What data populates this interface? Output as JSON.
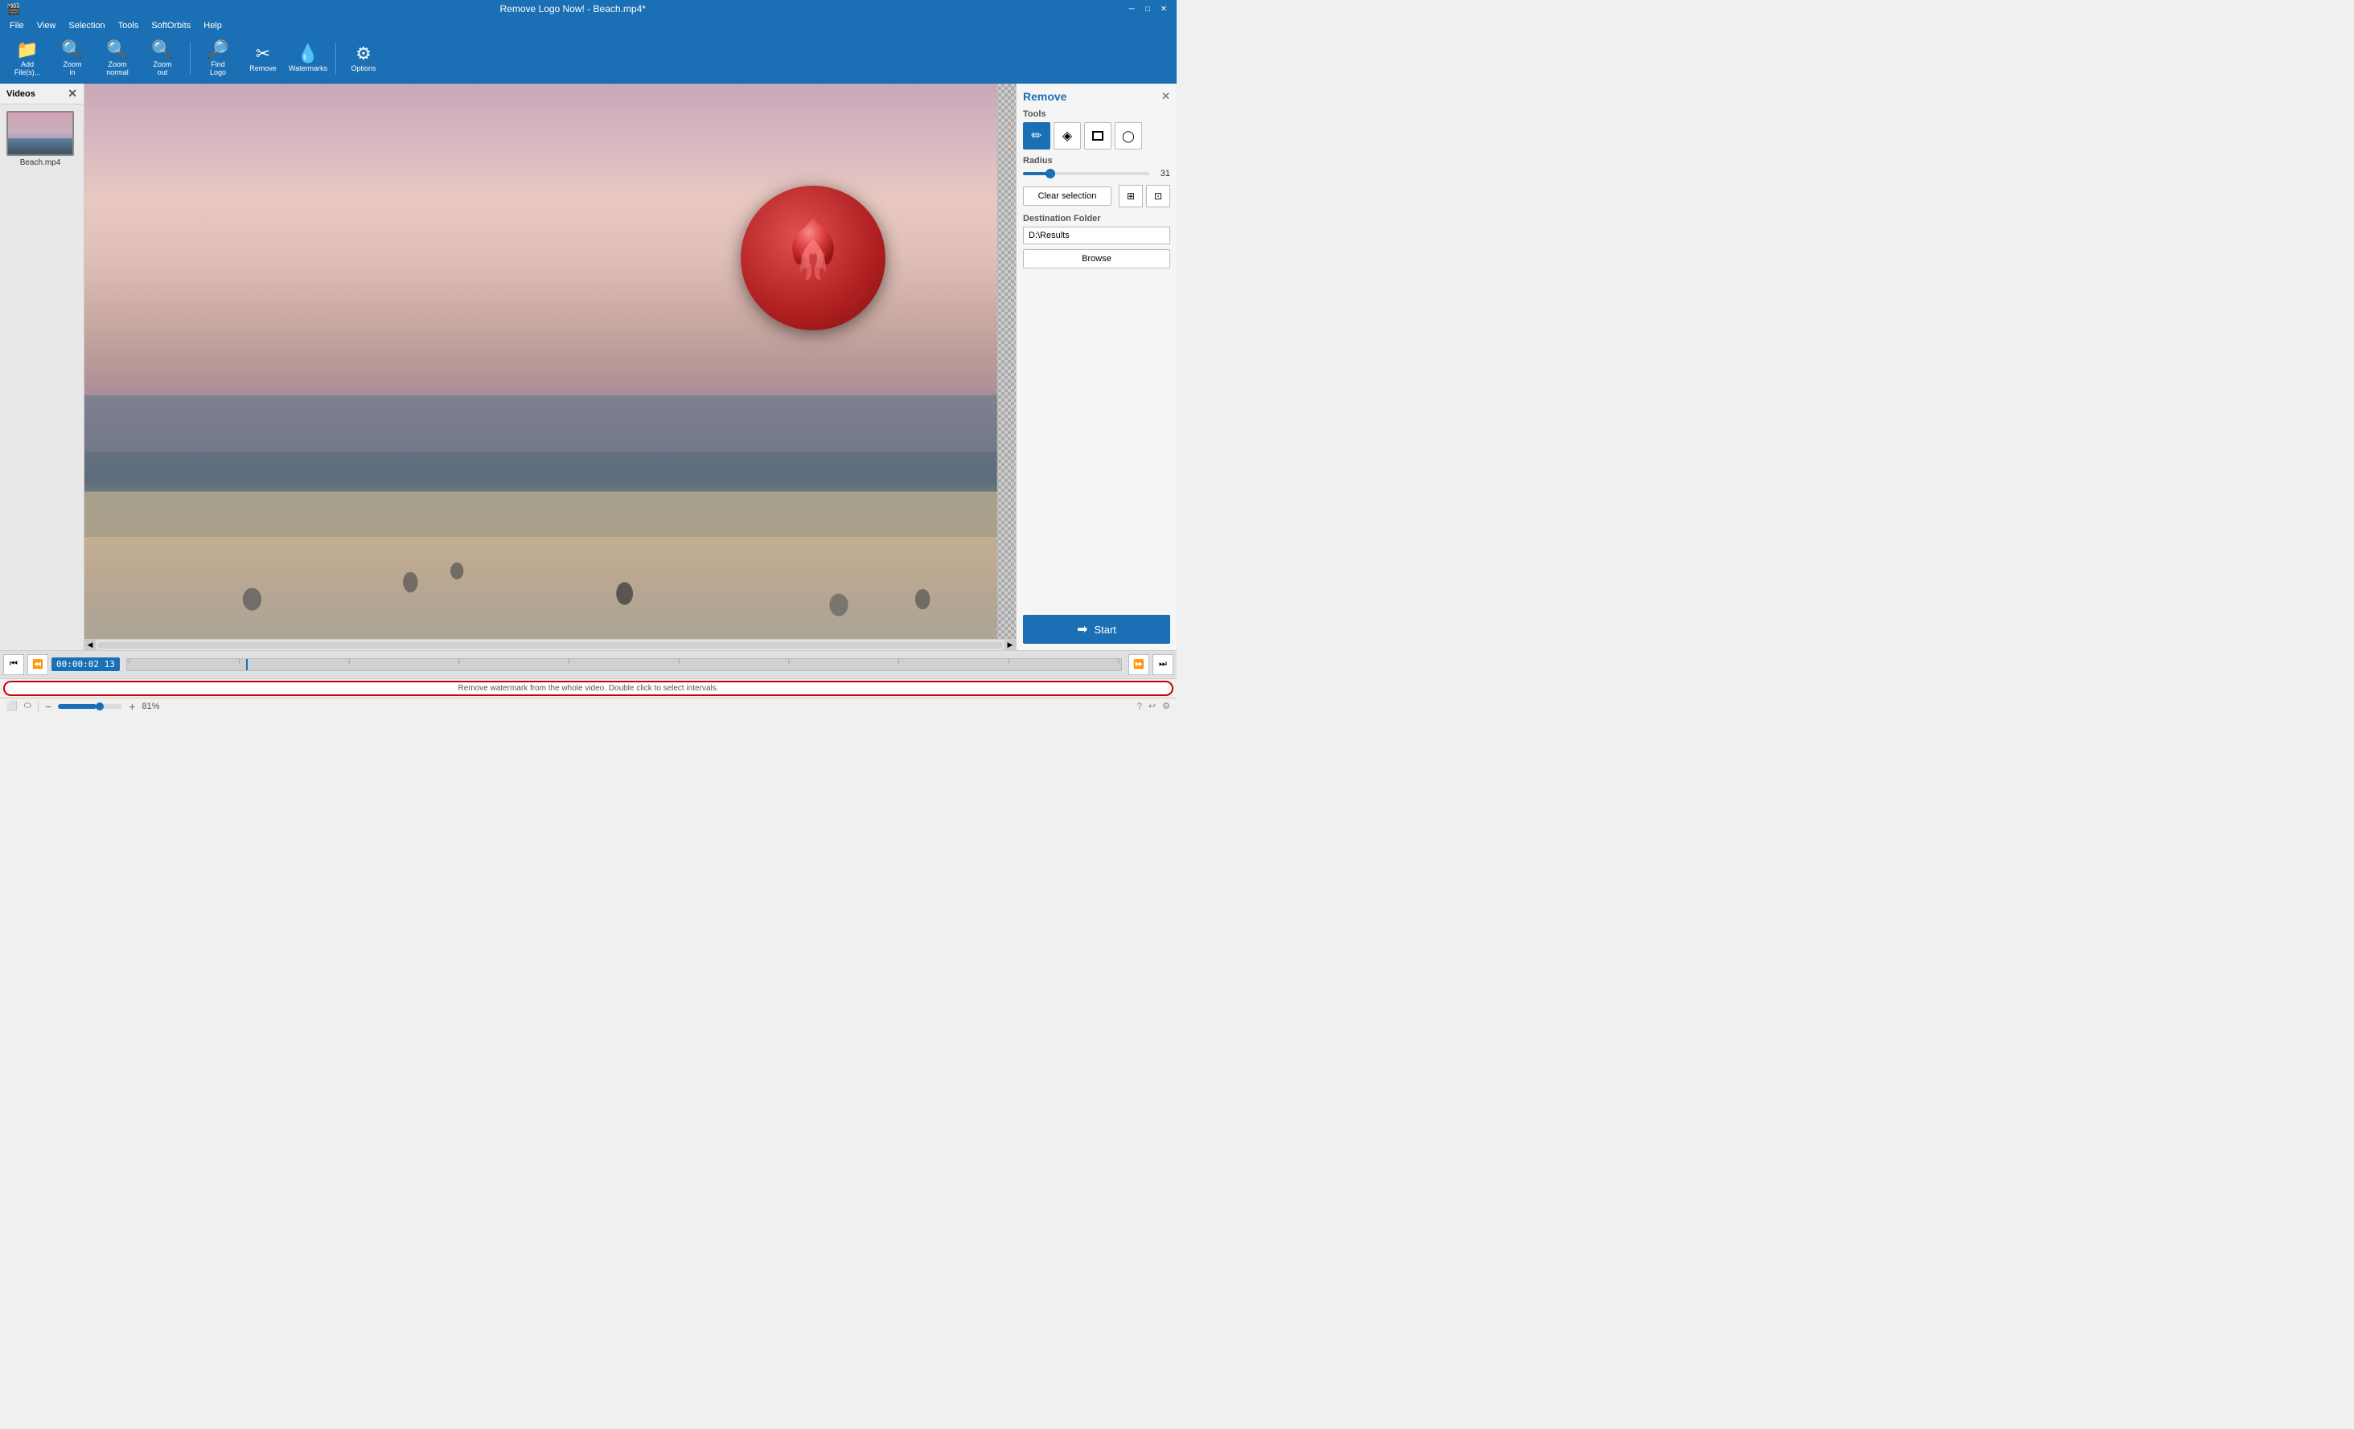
{
  "window": {
    "title": "Remove Logo Now! - Beach.mp4*",
    "app_icon": "🎬"
  },
  "titlebar": {
    "title": "Remove Logo Now! - Beach.mp4*",
    "minimize": "─",
    "maximize": "□",
    "close": "✕"
  },
  "menubar": {
    "items": [
      "File",
      "View",
      "Selection",
      "Tools",
      "SoftOrbits",
      "Help"
    ]
  },
  "toolbar": {
    "buttons": [
      {
        "icon": "📁",
        "label": "Add\nFile(s)..."
      },
      {
        "icon": "🔍",
        "label": "Zoom\nin"
      },
      {
        "icon": "🔍",
        "label": "Zoom\nnormal"
      },
      {
        "icon": "🔍",
        "label": "Zoom\nout"
      },
      {
        "icon": "🔎",
        "label": "Find\nLogo"
      },
      {
        "icon": "✂",
        "label": "Remove"
      },
      {
        "icon": "💧",
        "label": "Watermarks"
      },
      {
        "icon": "⚙",
        "label": "Options"
      }
    ]
  },
  "left_panel": {
    "header": "Videos",
    "videos": [
      {
        "name": "Beach.mp4"
      }
    ]
  },
  "right_panel": {
    "header": "Remove",
    "tools_label": "Tools",
    "tools": [
      {
        "id": "brush",
        "icon": "✏",
        "active": true
      },
      {
        "id": "eraser",
        "icon": "◈",
        "active": false
      },
      {
        "id": "rect",
        "icon": "⬜",
        "active": false
      },
      {
        "id": "circle",
        "icon": "◯",
        "active": false
      }
    ],
    "radius_label": "Radius",
    "radius_value": 31,
    "radius_percent": 20,
    "clear_selection": "Clear selection",
    "destination_folder_label": "Destination Folder",
    "destination_value": "D:\\Results",
    "browse_label": "Browse",
    "start_label": "Start"
  },
  "timeline": {
    "time_display": "00:00:02 13",
    "status_text": "Remove watermark from the whole video. Double click to select intervals."
  },
  "statusbar": {
    "zoom": "81%",
    "icons": [
      "help",
      "play",
      "settings"
    ]
  }
}
